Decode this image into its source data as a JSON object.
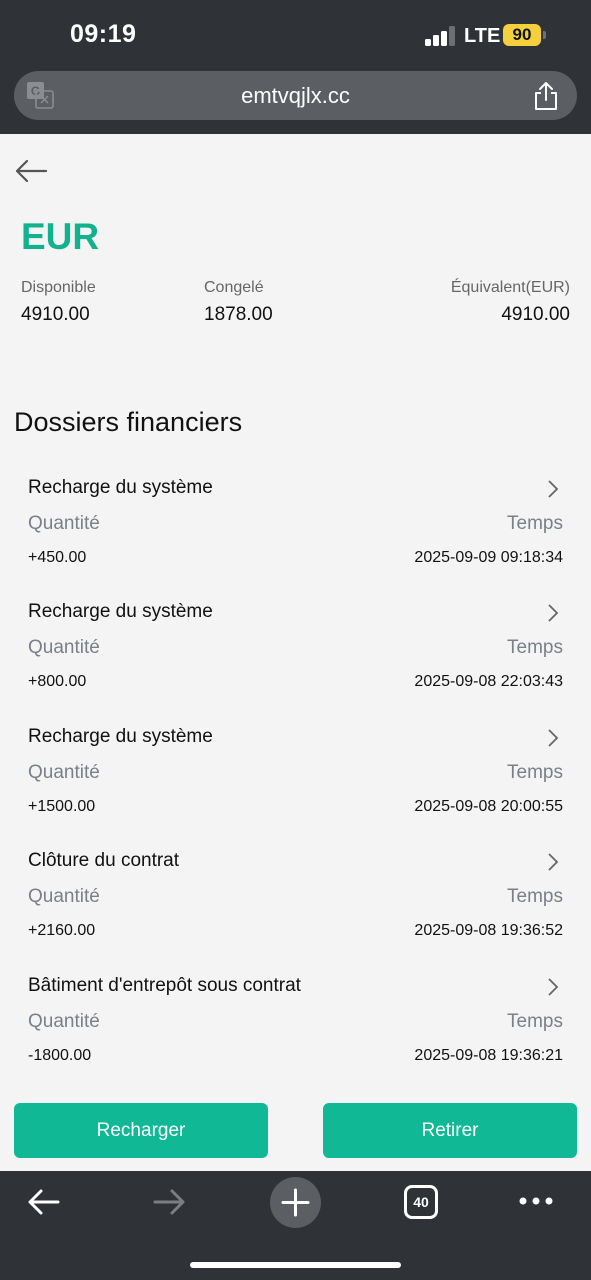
{
  "status_bar": {
    "time": "09:19",
    "network": "LTE",
    "battery": "90",
    "signal_bars_active": 3
  },
  "browser": {
    "url": "emtvqjlx.cc",
    "tab_count": "40",
    "icons": [
      "translate-icon",
      "share-icon",
      "back-icon",
      "forward-icon",
      "plus-icon",
      "tabs-icon",
      "more-icon"
    ]
  },
  "account": {
    "currency": "EUR",
    "available_label": "Disponible",
    "available_value": "4910.00",
    "frozen_label": "Congelé",
    "frozen_value": "1878.00",
    "equivalent_label": "Équivalent(EUR)",
    "equivalent_value": "4910.00"
  },
  "records_section": {
    "title": "Dossiers financiers",
    "records": [
      {
        "title": "Recharge du système",
        "quantity_label": "Quantité",
        "time_label": "Temps",
        "amount": "+450.00",
        "timestamp": "2025-09-09 09:18:34"
      },
      {
        "title": "Recharge du système",
        "quantity_label": "Quantité",
        "time_label": "Temps",
        "amount": "+800.00",
        "timestamp": "2025-09-08 22:03:43"
      },
      {
        "title": "Recharge du système",
        "quantity_label": "Quantité",
        "time_label": "Temps",
        "amount": "+1500.00",
        "timestamp": "2025-09-08 20:00:55"
      },
      {
        "title": "Clôture du contrat",
        "quantity_label": "Quantité",
        "time_label": "Temps",
        "amount": "+2160.00",
        "timestamp": "2025-09-08 19:36:52"
      },
      {
        "title": "Bâtiment d'entrepôt sous contrat",
        "quantity_label": "Quantité",
        "time_label": "Temps",
        "amount": "-1800.00",
        "timestamp": "2025-09-08 19:36:21"
      }
    ]
  },
  "actions": {
    "recharge_label": "Recharger",
    "withdraw_label": "Retirer"
  },
  "colors": {
    "accent": "#10b896",
    "currency_text": "#12b28f",
    "chrome": "#2f3236",
    "page_bg": "#f4f4f4"
  }
}
